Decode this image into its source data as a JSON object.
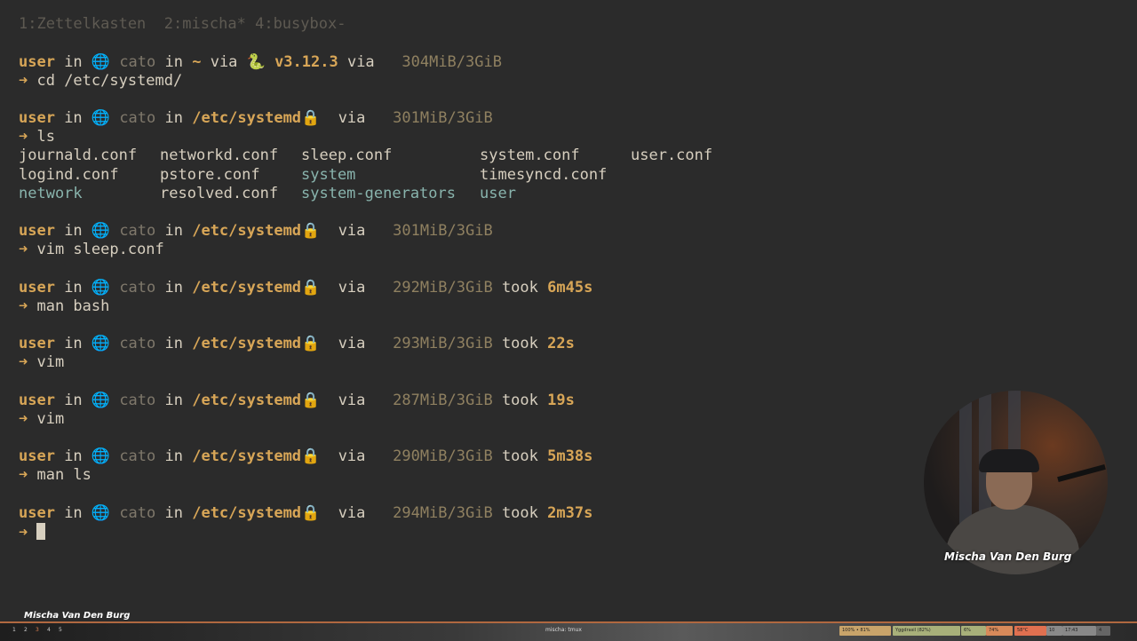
{
  "tabs": "1:Zettelkasten  2:mischa* 4:busybox-",
  "prompts": [
    {
      "user": "user",
      "in1": " in ",
      "globe": "🌐",
      "host": " cato",
      "in2": " in ",
      "path": "~",
      "via": " via ",
      "snake": "🐍",
      "ver": " v3.12.3",
      "via2": " via ",
      "mem": "  304MiB/3GiB",
      "cmd": "cd /etc/systemd/"
    },
    {
      "user": "user",
      "in1": " in ",
      "globe": "🌐",
      "host": " cato",
      "in2": " in ",
      "path": "/etc/systemd",
      "lock": "🔒",
      "via": "  via ",
      "mem": "  301MiB/3GiB",
      "cmd": "ls"
    },
    {
      "user": "user",
      "in1": " in ",
      "globe": "🌐",
      "host": " cato",
      "in2": " in ",
      "path": "/etc/systemd",
      "lock": "🔒",
      "via": "  via ",
      "mem": "  301MiB/3GiB",
      "cmd": "vim sleep.conf"
    },
    {
      "user": "user",
      "in1": " in ",
      "globe": "🌐",
      "host": " cato",
      "in2": " in ",
      "path": "/etc/systemd",
      "lock": "🔒",
      "via": "  via ",
      "mem": "  292MiB/3GiB",
      "took": " took ",
      "dur": "6m45s",
      "cmd": "man bash"
    },
    {
      "user": "user",
      "in1": " in ",
      "globe": "🌐",
      "host": " cato",
      "in2": " in ",
      "path": "/etc/systemd",
      "lock": "🔒",
      "via": "  via ",
      "mem": "  293MiB/3GiB",
      "took": " took ",
      "dur": "22s",
      "cmd": "vim"
    },
    {
      "user": "user",
      "in1": " in ",
      "globe": "🌐",
      "host": " cato",
      "in2": " in ",
      "path": "/etc/systemd",
      "lock": "🔒",
      "via": "  via ",
      "mem": "  287MiB/3GiB",
      "took": " took ",
      "dur": "19s",
      "cmd": "vim"
    },
    {
      "user": "user",
      "in1": " in ",
      "globe": "🌐",
      "host": " cato",
      "in2": " in ",
      "path": "/etc/systemd",
      "lock": "🔒",
      "via": "  via ",
      "mem": "  290MiB/3GiB",
      "took": " took ",
      "dur": "5m38s",
      "cmd": "man ls"
    },
    {
      "user": "user",
      "in1": " in ",
      "globe": "🌐",
      "host": " cato",
      "in2": " in ",
      "path": "/etc/systemd",
      "lock": "🔒",
      "via": "  via ",
      "mem": "  294MiB/3GiB",
      "took": " took ",
      "dur": "2m37s",
      "cmd": ""
    }
  ],
  "arrow": "➜",
  "ls_output": [
    [
      "journald.conf",
      "networkd.conf",
      "sleep.conf",
      "system.conf",
      "user.conf"
    ],
    [
      "logind.conf",
      "pstore.conf",
      "system",
      "timesyncd.conf",
      ""
    ],
    [
      "network",
      "resolved.conf",
      "system-generators",
      "user",
      ""
    ]
  ],
  "ls_dirs": [
    "network",
    "system",
    "system-generators",
    "user"
  ],
  "webcam_name": "Mischa Van Den Burg",
  "frame_name": "Mischa Van Den Burg",
  "statusbar": {
    "workspaces": [
      "1",
      "2",
      "3",
      "4",
      "5"
    ],
    "active_workspace": "3",
    "title": "mischa: tmux",
    "pills": [
      {
        "text": "100% • 81%",
        "color": "#c9a46a"
      },
      {
        "text": "Yggdrasil (82%)",
        "color": "#a8b07a"
      },
      {
        "text": "6%",
        "color": "#a8b07a"
      },
      {
        "text": "74%",
        "color": "#d88a5a"
      },
      {
        "text": "58°C",
        "color": "#e07050"
      },
      {
        "text": "10",
        "color": "#8a8a8a"
      },
      {
        "text": "17:43",
        "color": "#888"
      },
      {
        "text": "4",
        "color": "#666"
      }
    ]
  }
}
